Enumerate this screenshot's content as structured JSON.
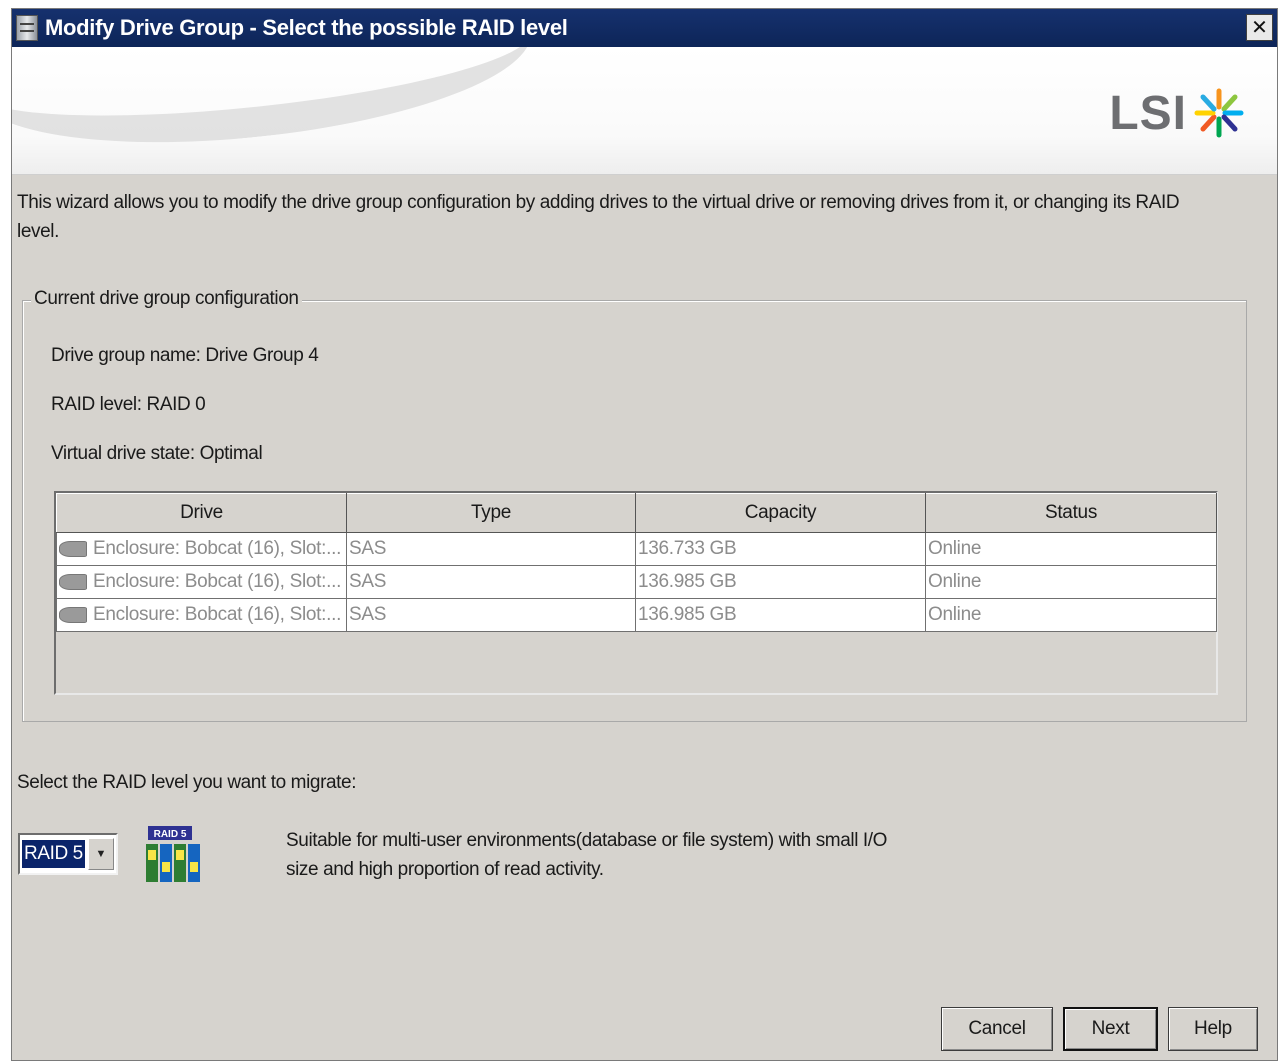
{
  "window": {
    "title": "Modify Drive Group - Select the possible RAID level",
    "close_glyph": "✕"
  },
  "banner": {
    "logo_text": "LSI",
    "logo_icon": "lsi-starburst-icon"
  },
  "intro_text": "This wizard allows you to modify the drive group configuration by adding drives to the virtual drive or removing drives from it, or changing its RAID level.",
  "current_config": {
    "legend": "Current drive group configuration",
    "drive_group_name": "Drive group name: Drive Group 4",
    "raid_level": "RAID level: RAID 0",
    "virtual_drive_state": "Virtual drive state: Optimal"
  },
  "drives_table": {
    "columns": [
      "Drive",
      "Type",
      "Capacity",
      "Status"
    ],
    "rows": [
      {
        "drive": "Enclosure: Bobcat (16), Slot:...",
        "type": "SAS",
        "capacity": "136.733 GB",
        "status": "Online"
      },
      {
        "drive": "Enclosure: Bobcat (16), Slot:...",
        "type": "SAS",
        "capacity": "136.985 GB",
        "status": "Online"
      },
      {
        "drive": "Enclosure: Bobcat (16), Slot:...",
        "type": "SAS",
        "capacity": "136.985 GB",
        "status": "Online"
      }
    ]
  },
  "migrate": {
    "label": "Select the RAID level you want to migrate:",
    "selected": "RAID 5",
    "icon_label": "RAID 5",
    "description": "Suitable for multi-user environments(database or file system) with small I/O size and high proportion of read activity."
  },
  "buttons": {
    "cancel": "Cancel",
    "next": "Next",
    "help": "Help"
  },
  "colors": {
    "titlebar": "#0d2558",
    "dialog_bg": "#d6d3ce",
    "selection": "#0a246a"
  }
}
